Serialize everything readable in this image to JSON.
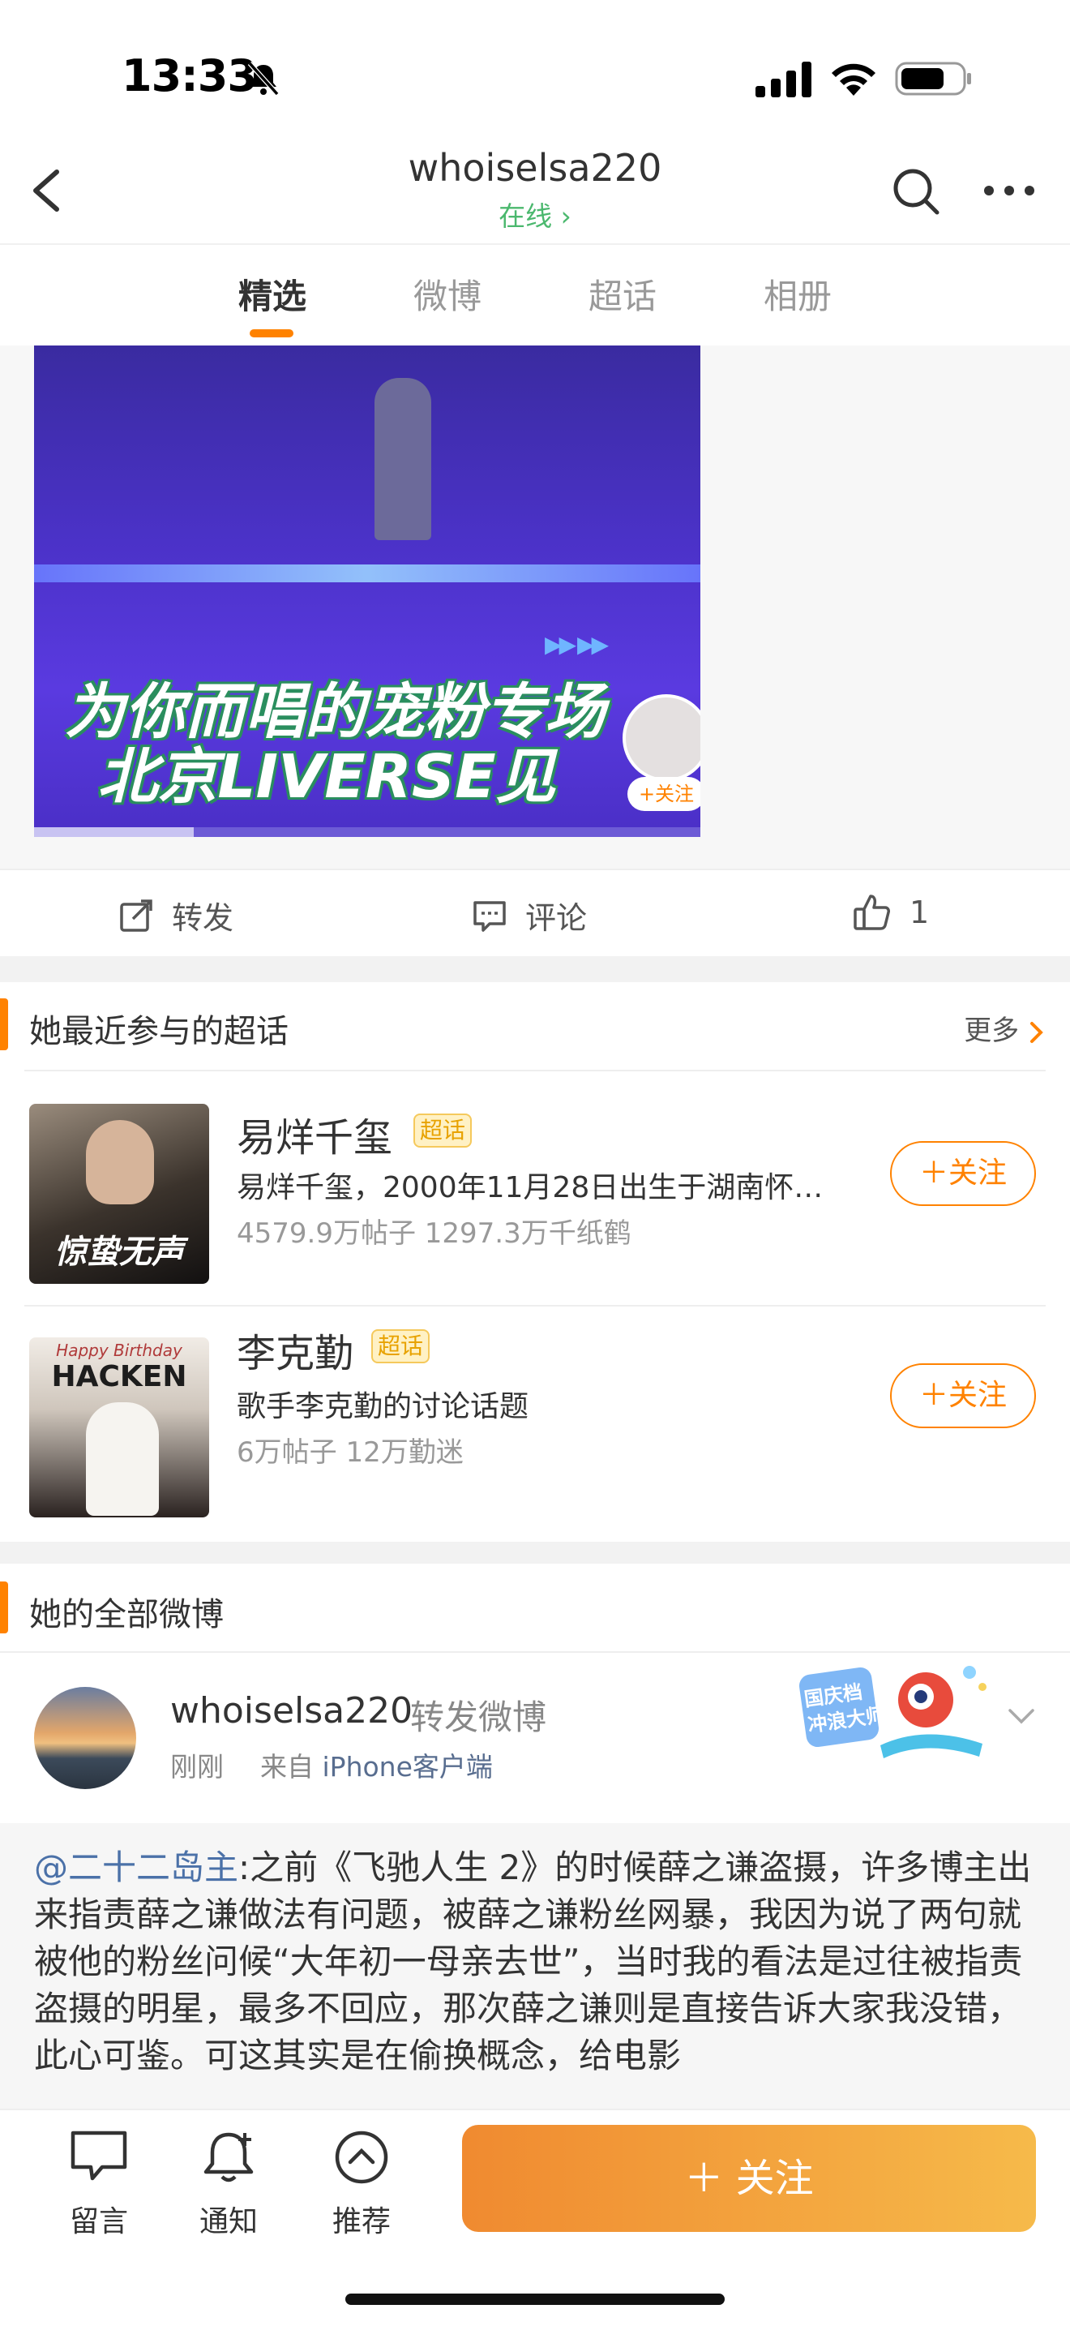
{
  "status_bar": {
    "time": "13:33"
  },
  "header": {
    "title": "whoiselsa220",
    "status": "在线 ›"
  },
  "tabs": [
    {
      "label": "精选",
      "active": true
    },
    {
      "label": "微博",
      "active": false
    },
    {
      "label": "超话",
      "active": false
    },
    {
      "label": "相册",
      "active": false
    }
  ],
  "video": {
    "banner_line1": "为你而唱的宠粉专场",
    "banner_line2": "北京LIVERSE见",
    "mini_follow": "+关注",
    "progress": 0.24
  },
  "actions": {
    "repost": "转发",
    "comment": "评论",
    "like_count": "1"
  },
  "supertopics": {
    "title": "她最近参与的超话",
    "more": "更多",
    "items": [
      {
        "name": "易烊千玺",
        "badge": "超话",
        "desc": "易烊千玺，2000年11月28日出生于湖南怀…",
        "stats": "4579.9万帖子 1297.3万千纸鹤",
        "follow": "＋关注",
        "image_text": "惊蛰无声"
      },
      {
        "name": "李克勤",
        "badge": "超话",
        "desc": "歌手李克勤的讨论话题",
        "stats": "6万帖子 12万勤迷",
        "follow": "＋关注",
        "image_text_1": "Happy Birthday",
        "image_text_2": "HACKEN"
      }
    ]
  },
  "posts": {
    "title": "她的全部微博",
    "user": "whoiselsa220",
    "action": "转发微博",
    "time": "刚刚",
    "from_prefix": "来自",
    "source": "iPhone客户端",
    "sticker_text": "国庆档 冲浪大师",
    "mention": "@二十二岛主",
    "body": ":之前《飞驰人生 2》的时候薛之谦盗摄，许多博主出来指责薛之谦做法有问题，被薛之谦粉丝网暴，我因为说了两句就被他的粉丝问候“大年初一母亲去世”，当时我的看法是过往被指责盗摄的明星，最多不回应，那次薛之谦则是直接告诉大家我没错，此心可鉴。可这其实是在偷换概念，给电影"
  },
  "bottom_bar": {
    "message": "留言",
    "notify": "通知",
    "recommend": "推荐",
    "follow": "＋ 关注"
  },
  "colors": {
    "accent": "#ff8200",
    "online": "#4bb86e",
    "link": "#4b71a8"
  },
  "icons": [
    "mute-icon",
    "signal-icon",
    "wifi-icon",
    "battery-icon",
    "back-icon",
    "search-icon",
    "more-icon",
    "repost-icon",
    "comment-icon",
    "like-icon",
    "chevron-right-icon",
    "chevron-down-icon",
    "message-icon",
    "bell-icon",
    "recommend-icon"
  ]
}
